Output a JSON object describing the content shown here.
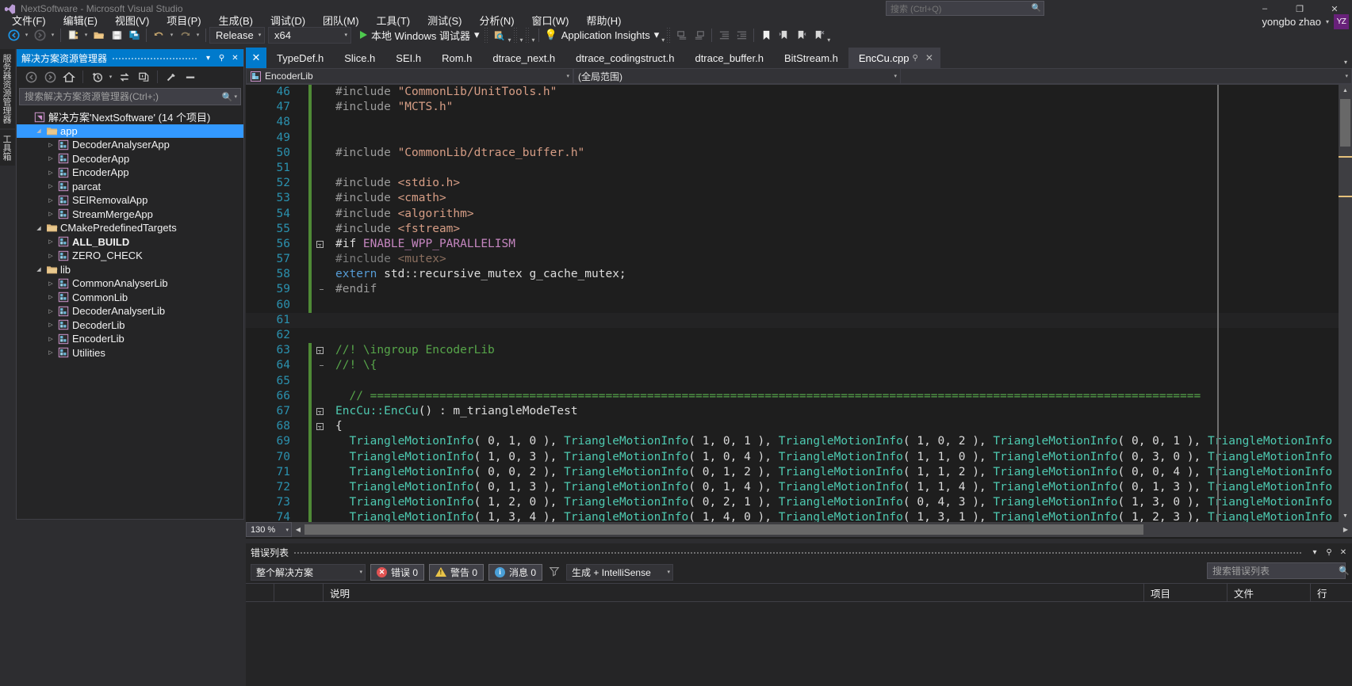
{
  "window": {
    "title": "NextSoftware - Microsoft Visual Studio",
    "search_placeholder": "搜索 (Ctrl+Q)",
    "minimize": "–",
    "maximize": "❐",
    "close": "✕"
  },
  "menu": {
    "items": [
      "文件(F)",
      "编辑(E)",
      "视图(V)",
      "项目(P)",
      "生成(B)",
      "调试(D)",
      "团队(M)",
      "工具(T)",
      "测试(S)",
      "分析(N)",
      "窗口(W)",
      "帮助(H)"
    ]
  },
  "account": {
    "name": "yongbo zhao",
    "caret": "▾",
    "initials": "YZ"
  },
  "toolbar": {
    "back_icon": "back-arrow-icon",
    "forward_icon": "forward-arrow-icon",
    "new_project_icon": "new-project-icon",
    "open_icon": "open-folder-icon",
    "save_icon": "save-icon",
    "save_all_icon": "save-all-icon",
    "undo_icon": "undo-icon",
    "redo_icon": "redo-icon",
    "config_value": "Release",
    "platform_value": "x64",
    "run_label": "本地 Windows 调试器",
    "app_insights_label": "Application Insights",
    "caret": "▾"
  },
  "sidebar_vtabs": [
    "服务器资源管理器",
    "工具箱"
  ],
  "solution_explorer": {
    "title": "解决方案资源管理器",
    "header_caret": "▾",
    "header_pin": "⚲",
    "header_close": "✕",
    "toolbar_icons": [
      "back-arrow-icon",
      "forward-arrow-icon",
      "home-icon",
      "pending-changes-icon",
      "sync-with-active-document-icon",
      "collapse-all-icon",
      "properties-icon",
      "show-all-files-icon"
    ],
    "search_placeholder": "搜索解决方案资源管理器(Ctrl+;)",
    "search_value": "",
    "tree": [
      {
        "label": "解决方案'NextSoftware' (14 个项目)",
        "indent": 0,
        "icon": "solution-icon",
        "expander": "",
        "bold": false,
        "selected": false
      },
      {
        "label": "app",
        "indent": 1,
        "icon": "folder-icon",
        "expander": "◢",
        "bold": false,
        "selected": true
      },
      {
        "label": "DecoderAnalyserApp",
        "indent": 2,
        "icon": "project-icon",
        "expander": "▷",
        "bold": false,
        "selected": false
      },
      {
        "label": "DecoderApp",
        "indent": 2,
        "icon": "project-icon",
        "expander": "▷",
        "bold": false,
        "selected": false
      },
      {
        "label": "EncoderApp",
        "indent": 2,
        "icon": "project-icon",
        "expander": "▷",
        "bold": false,
        "selected": false
      },
      {
        "label": "parcat",
        "indent": 2,
        "icon": "project-icon",
        "expander": "▷",
        "bold": false,
        "selected": false
      },
      {
        "label": "SEIRemovalApp",
        "indent": 2,
        "icon": "project-icon",
        "expander": "▷",
        "bold": false,
        "selected": false
      },
      {
        "label": "StreamMergeApp",
        "indent": 2,
        "icon": "project-icon",
        "expander": "▷",
        "bold": false,
        "selected": false
      },
      {
        "label": "CMakePredefinedTargets",
        "indent": 1,
        "icon": "folder-icon",
        "expander": "◢",
        "bold": false,
        "selected": false
      },
      {
        "label": "ALL_BUILD",
        "indent": 2,
        "icon": "project-icon",
        "expander": "▷",
        "bold": true,
        "selected": false
      },
      {
        "label": "ZERO_CHECK",
        "indent": 2,
        "icon": "project-icon",
        "expander": "▷",
        "bold": false,
        "selected": false
      },
      {
        "label": "lib",
        "indent": 1,
        "icon": "folder-icon",
        "expander": "◢",
        "bold": false,
        "selected": false
      },
      {
        "label": "CommonAnalyserLib",
        "indent": 2,
        "icon": "project-icon",
        "expander": "▷",
        "bold": false,
        "selected": false
      },
      {
        "label": "CommonLib",
        "indent": 2,
        "icon": "project-icon",
        "expander": "▷",
        "bold": false,
        "selected": false
      },
      {
        "label": "DecoderAnalyserLib",
        "indent": 2,
        "icon": "project-icon",
        "expander": "▷",
        "bold": false,
        "selected": false
      },
      {
        "label": "DecoderLib",
        "indent": 2,
        "icon": "project-icon",
        "expander": "▷",
        "bold": false,
        "selected": false
      },
      {
        "label": "EncoderLib",
        "indent": 2,
        "icon": "project-icon",
        "expander": "▷",
        "bold": false,
        "selected": false
      },
      {
        "label": "Utilities",
        "indent": 2,
        "icon": "project-icon",
        "expander": "▷",
        "bold": false,
        "selected": false
      }
    ]
  },
  "editor": {
    "close_x": "✕",
    "tabs": [
      {
        "label": "TypeDef.h",
        "active": false
      },
      {
        "label": "Slice.h",
        "active": false
      },
      {
        "label": "SEI.h",
        "active": false
      },
      {
        "label": "Rom.h",
        "active": false
      },
      {
        "label": "dtrace_next.h",
        "active": false
      },
      {
        "label": "dtrace_codingstruct.h",
        "active": false
      },
      {
        "label": "dtrace_buffer.h",
        "active": false
      },
      {
        "label": "BitStream.h",
        "active": false
      },
      {
        "label": "EncCu.cpp",
        "active": true,
        "pin": "⚲",
        "close": "✕"
      }
    ],
    "tabstrip_overflow": "▾",
    "nav_project": "EncoderLib",
    "nav_scope": "(全局范围)",
    "nav_member": "",
    "zoom": "130 %",
    "lines": [
      {
        "n": 46,
        "changed": true,
        "fold": "",
        "tokens": [
          {
            "t": "#include ",
            "c": "t-pp"
          },
          {
            "t": "\"CommonLib/UnitTools.h\"",
            "c": "t-str"
          }
        ]
      },
      {
        "n": 47,
        "changed": true,
        "fold": "",
        "tokens": [
          {
            "t": "#include ",
            "c": "t-pp"
          },
          {
            "t": "\"MCTS.h\"",
            "c": "t-str"
          }
        ]
      },
      {
        "n": 48,
        "changed": true,
        "fold": "",
        "tokens": []
      },
      {
        "n": 49,
        "changed": true,
        "fold": "",
        "tokens": []
      },
      {
        "n": 50,
        "changed": true,
        "fold": "",
        "tokens": [
          {
            "t": "#include ",
            "c": "t-pp"
          },
          {
            "t": "\"CommonLib/dtrace_buffer.h\"",
            "c": "t-str"
          }
        ]
      },
      {
        "n": 51,
        "changed": true,
        "fold": "",
        "tokens": []
      },
      {
        "n": 52,
        "changed": true,
        "fold": "",
        "tokens": [
          {
            "t": "#include ",
            "c": "t-pp"
          },
          {
            "t": "<stdio.h>",
            "c": "t-str"
          }
        ]
      },
      {
        "n": 53,
        "changed": true,
        "fold": "",
        "tokens": [
          {
            "t": "#include ",
            "c": "t-pp"
          },
          {
            "t": "<cmath>",
            "c": "t-str"
          }
        ]
      },
      {
        "n": 54,
        "changed": true,
        "fold": "",
        "tokens": [
          {
            "t": "#include ",
            "c": "t-pp"
          },
          {
            "t": "<algorithm>",
            "c": "t-str"
          }
        ]
      },
      {
        "n": 55,
        "changed": true,
        "fold": "",
        "tokens": [
          {
            "t": "#include ",
            "c": "t-pp"
          },
          {
            "t": "<fstream>",
            "c": "t-str"
          }
        ]
      },
      {
        "n": 56,
        "changed": true,
        "fold": "minus",
        "tokens": [
          {
            "t": "#if ",
            "c": "t-ppa"
          },
          {
            "t": "ENABLE_WPP_PARALLELISM",
            "c": "t-mac"
          }
        ]
      },
      {
        "n": 57,
        "changed": true,
        "fold": "line",
        "tokens": [
          {
            "t": "#include ",
            "c": "t-dim"
          },
          {
            "t": "<mutex>",
            "c": "t-dimstr"
          }
        ]
      },
      {
        "n": 58,
        "changed": true,
        "fold": "line",
        "tokens": [
          {
            "t": "extern",
            "c": "t-kw"
          },
          {
            "t": " std::recursive_mutex g_cache_mutex;",
            "c": "t-plain"
          }
        ]
      },
      {
        "n": 59,
        "changed": true,
        "fold": "end",
        "tokens": [
          {
            "t": "#endif",
            "c": "t-pp"
          }
        ]
      },
      {
        "n": 60,
        "changed": true,
        "fold": "",
        "tokens": []
      },
      {
        "n": 61,
        "changed": false,
        "fold": "",
        "current": true,
        "tokens": []
      },
      {
        "n": 62,
        "changed": false,
        "fold": "",
        "tokens": []
      },
      {
        "n": 63,
        "changed": true,
        "fold": "minus",
        "tokens": [
          {
            "t": "//! \\ingroup EncoderLib",
            "c": "t-cmt"
          }
        ]
      },
      {
        "n": 64,
        "changed": true,
        "fold": "end",
        "tokens": [
          {
            "t": "//! \\{",
            "c": "t-cmt"
          }
        ]
      },
      {
        "n": 65,
        "changed": true,
        "fold": "",
        "tokens": []
      },
      {
        "n": 66,
        "changed": true,
        "fold": "",
        "tokens": [
          {
            "t": "  // ========================================================================================================================",
            "c": "t-cmt"
          }
        ]
      },
      {
        "n": 67,
        "changed": true,
        "fold": "minus",
        "tokens": [
          {
            "t": "EncCu::EncCu",
            "c": "t-type"
          },
          {
            "t": "() : m_triangleModeTest",
            "c": "t-plain"
          }
        ]
      },
      {
        "n": 68,
        "changed": true,
        "fold": "minus2",
        "tokens": [
          {
            "t": "{",
            "c": "t-punc"
          }
        ]
      },
      {
        "n": 69,
        "changed": true,
        "fold": "line",
        "tokens": [
          {
            "t": "  ",
            "c": "t-plain"
          },
          {
            "t": "TriangleMotionInfo",
            "c": "t-type"
          },
          {
            "t": "( 0, 1, 0 ), ",
            "c": "t-plain"
          },
          {
            "t": "TriangleMotionInfo",
            "c": "t-type"
          },
          {
            "t": "( 1, 0, 1 ), ",
            "c": "t-plain"
          },
          {
            "t": "TriangleMotionInfo",
            "c": "t-type"
          },
          {
            "t": "( 1, 0, 2 ), ",
            "c": "t-plain"
          },
          {
            "t": "TriangleMotionInfo",
            "c": "t-type"
          },
          {
            "t": "( 0, 0, 1 ), ",
            "c": "t-plain"
          },
          {
            "t": "TriangleMotionInfo",
            "c": "t-type"
          }
        ]
      },
      {
        "n": 70,
        "changed": true,
        "fold": "line",
        "tokens": [
          {
            "t": "  ",
            "c": "t-plain"
          },
          {
            "t": "TriangleMotionInfo",
            "c": "t-type"
          },
          {
            "t": "( 1, 0, 3 ), ",
            "c": "t-plain"
          },
          {
            "t": "TriangleMotionInfo",
            "c": "t-type"
          },
          {
            "t": "( 1, 0, 4 ), ",
            "c": "t-plain"
          },
          {
            "t": "TriangleMotionInfo",
            "c": "t-type"
          },
          {
            "t": "( 1, 1, 0 ), ",
            "c": "t-plain"
          },
          {
            "t": "TriangleMotionInfo",
            "c": "t-type"
          },
          {
            "t": "( 0, 3, 0 ), ",
            "c": "t-plain"
          },
          {
            "t": "TriangleMotionInfo",
            "c": "t-type"
          }
        ]
      },
      {
        "n": 71,
        "changed": true,
        "fold": "line",
        "tokens": [
          {
            "t": "  ",
            "c": "t-plain"
          },
          {
            "t": "TriangleMotionInfo",
            "c": "t-type"
          },
          {
            "t": "( 0, 0, 2 ), ",
            "c": "t-plain"
          },
          {
            "t": "TriangleMotionInfo",
            "c": "t-type"
          },
          {
            "t": "( 0, 1, 2 ), ",
            "c": "t-plain"
          },
          {
            "t": "TriangleMotionInfo",
            "c": "t-type"
          },
          {
            "t": "( 1, 1, 2 ), ",
            "c": "t-plain"
          },
          {
            "t": "TriangleMotionInfo",
            "c": "t-type"
          },
          {
            "t": "( 0, 0, 4 ), ",
            "c": "t-plain"
          },
          {
            "t": "TriangleMotionInfo",
            "c": "t-type"
          }
        ]
      },
      {
        "n": 72,
        "changed": true,
        "fold": "line",
        "tokens": [
          {
            "t": "  ",
            "c": "t-plain"
          },
          {
            "t": "TriangleMotionInfo",
            "c": "t-type"
          },
          {
            "t": "( 0, 1, 3 ), ",
            "c": "t-plain"
          },
          {
            "t": "TriangleMotionInfo",
            "c": "t-type"
          },
          {
            "t": "( 0, 1, 4 ), ",
            "c": "t-plain"
          },
          {
            "t": "TriangleMotionInfo",
            "c": "t-type"
          },
          {
            "t": "( 1, 1, 4 ), ",
            "c": "t-plain"
          },
          {
            "t": "TriangleMotionInfo",
            "c": "t-type"
          },
          {
            "t": "( 0, 1, 3 ), ",
            "c": "t-plain"
          },
          {
            "t": "TriangleMotionInfo",
            "c": "t-type"
          }
        ]
      },
      {
        "n": 73,
        "changed": true,
        "fold": "line",
        "tokens": [
          {
            "t": "  ",
            "c": "t-plain"
          },
          {
            "t": "TriangleMotionInfo",
            "c": "t-type"
          },
          {
            "t": "( 1, 2, 0 ), ",
            "c": "t-plain"
          },
          {
            "t": "TriangleMotionInfo",
            "c": "t-type"
          },
          {
            "t": "( 0, 2, 1 ), ",
            "c": "t-plain"
          },
          {
            "t": "TriangleMotionInfo",
            "c": "t-type"
          },
          {
            "t": "( 0, 4, 3 ), ",
            "c": "t-plain"
          },
          {
            "t": "TriangleMotionInfo",
            "c": "t-type"
          },
          {
            "t": "( 1, 3, 0 ), ",
            "c": "t-plain"
          },
          {
            "t": "TriangleMotionInfo",
            "c": "t-type"
          }
        ]
      },
      {
        "n": 74,
        "changed": true,
        "fold": "line",
        "tokens": [
          {
            "t": "  ",
            "c": "t-plain"
          },
          {
            "t": "TriangleMotionInfo",
            "c": "t-type"
          },
          {
            "t": "( 1, 3, 4 ), ",
            "c": "t-plain"
          },
          {
            "t": "TriangleMotionInfo",
            "c": "t-type"
          },
          {
            "t": "( 1, 4, 0 ), ",
            "c": "t-plain"
          },
          {
            "t": "TriangleMotionInfo",
            "c": "t-type"
          },
          {
            "t": "( 1, 3, 1 ), ",
            "c": "t-plain"
          },
          {
            "t": "TriangleMotionInfo",
            "c": "t-type"
          },
          {
            "t": "( 1, 2, 3 ), ",
            "c": "t-plain"
          },
          {
            "t": "TriangleMotionInfo",
            "c": "t-type"
          }
        ]
      }
    ]
  },
  "error_list": {
    "title": "错误列表",
    "header_caret": "▾",
    "header_pin": "⚲",
    "header_close": "✕",
    "scope_value": "整个解决方案",
    "errors_label": "错误 0",
    "warnings_label": "警告 0",
    "messages_label": "消息 0",
    "build_filter_value": "生成 + IntelliSense",
    "search_placeholder": "搜索错误列表",
    "columns": [
      "",
      "",
      "说明",
      "项目",
      "文件",
      "行"
    ],
    "rows": []
  }
}
